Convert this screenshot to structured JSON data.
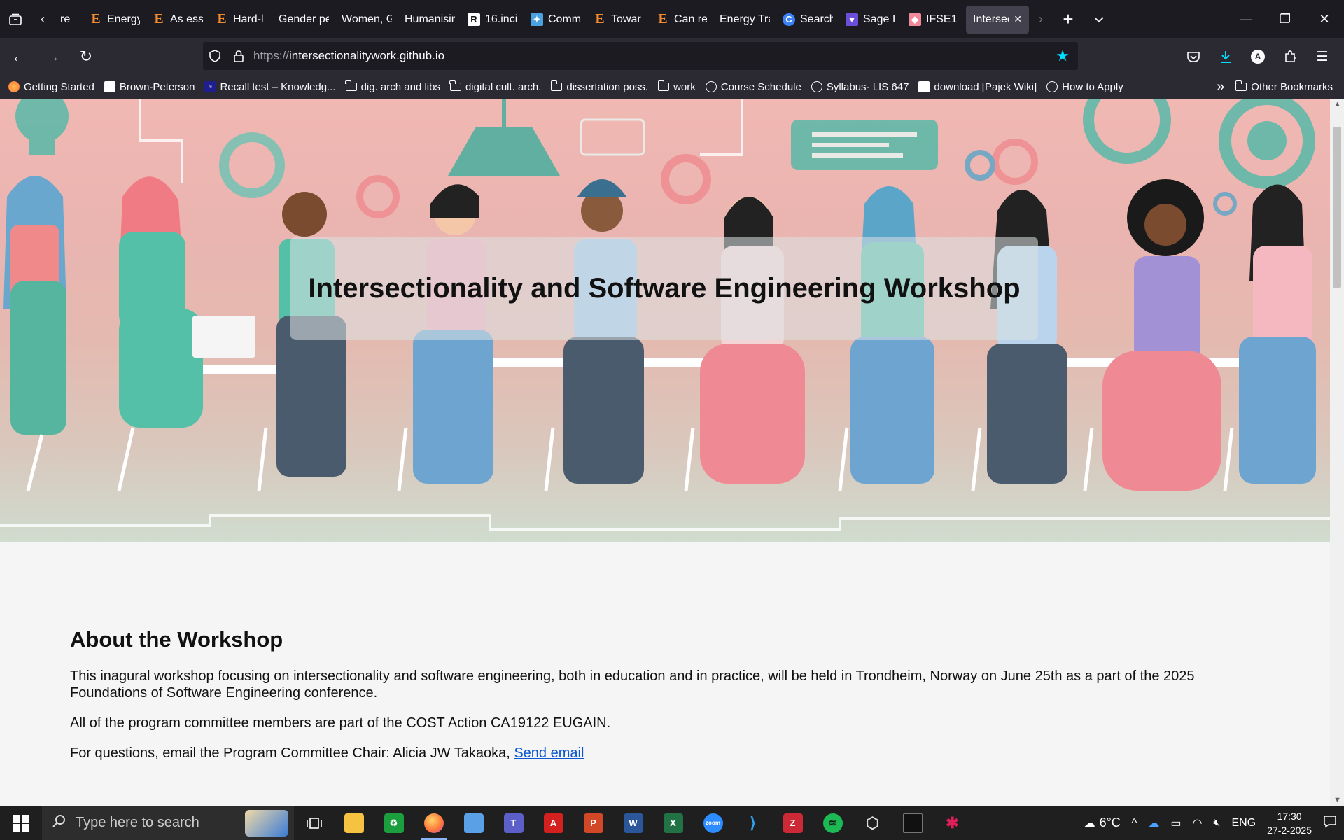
{
  "browser": {
    "tabs": [
      {
        "label": "re",
        "icon": "generic-tab-icon"
      },
      {
        "label": "Energy",
        "icon": "elsevier-icon"
      },
      {
        "label": "As ess",
        "icon": "elsevier-icon"
      },
      {
        "label": "Hard-l",
        "icon": "elsevier-icon"
      },
      {
        "label": "Gender pe",
        "icon": "none"
      },
      {
        "label": "Women, G",
        "icon": "none"
      },
      {
        "label": "Humanisin",
        "icon": "none"
      },
      {
        "label": "16.inci",
        "icon": "researchgate-icon"
      },
      {
        "label": "Comm",
        "icon": "puzzle-icon"
      },
      {
        "label": "Towar",
        "icon": "elsevier-icon"
      },
      {
        "label": "Can re",
        "icon": "elsevier-icon"
      },
      {
        "label": "Energy Tra",
        "icon": "none"
      },
      {
        "label": "Search",
        "icon": "c-icon"
      },
      {
        "label": "Sage I",
        "icon": "heart-icon"
      },
      {
        "label": "IFSE1",
        "icon": "pink-icon"
      },
      {
        "label": "Intersec",
        "icon": "none",
        "active": true
      }
    ],
    "url": {
      "proto": "https://",
      "host": "intersectionalitywork.github.io"
    },
    "bookmarks": [
      {
        "label": "Getting Started",
        "icon": "firefox-icon"
      },
      {
        "label": "Brown-Peterson",
        "icon": "page-icon"
      },
      {
        "label": "Recall test – Knowledg...",
        "icon": "recall-icon"
      },
      {
        "label": "dig. arch and libs",
        "icon": "folder-icon"
      },
      {
        "label": "digital cult. arch.",
        "icon": "folder-icon"
      },
      {
        "label": "dissertation poss.",
        "icon": "folder-icon"
      },
      {
        "label": "work",
        "icon": "folder-icon"
      },
      {
        "label": "Course Schedule",
        "icon": "globe-icon"
      },
      {
        "label": "Syllabus- LIS 647",
        "icon": "globe-icon"
      },
      {
        "label": "download [Pajek Wiki]",
        "icon": "pajek-icon"
      },
      {
        "label": "How to Apply",
        "icon": "globe-icon"
      }
    ],
    "other_bookmarks": "Other Bookmarks"
  },
  "page": {
    "hero_title": "Intersectionality and Software Engineering Workshop",
    "about_heading": "About the Workshop",
    "p1": "This inagural workshop focusing on intersectionality and software engineering, both in education and in practice, will be held in Trondheim, Norway on June 25th as a part of the 2025 Foundations of Software Engineering conference.",
    "p2": "All of the program committee members are part of the COST Action CA19122 EUGAIN.",
    "p3_prefix": "For questions, email the Program Committee Chair: Alicia JW Takaoka, ",
    "p3_link": "Send email"
  },
  "taskbar": {
    "search_placeholder": "Type here to search",
    "weather": "6°C",
    "lang": "ENG",
    "time": "17:30",
    "date": "27-2-2025",
    "apps": [
      {
        "name": "task-view",
        "label": "",
        "color": "#1f1f1f"
      },
      {
        "name": "file-explorer",
        "label": "",
        "color": "#f5c242"
      },
      {
        "name": "recycle-app",
        "label": "♻",
        "color": "#1b9e3e"
      },
      {
        "name": "firefox",
        "label": "",
        "color": "#ff7139",
        "active": true
      },
      {
        "name": "maps",
        "label": "",
        "color": "#5aa0e6"
      },
      {
        "name": "teams",
        "label": "T",
        "color": "#5b5fc7"
      },
      {
        "name": "acrobat",
        "label": "A",
        "color": "#d4201f"
      },
      {
        "name": "powerpoint",
        "label": "P",
        "color": "#d24726"
      },
      {
        "name": "word",
        "label": "W",
        "color": "#2b579a"
      },
      {
        "name": "excel",
        "label": "X",
        "color": "#217346"
      },
      {
        "name": "zoom",
        "label": "zoom",
        "color": "#2d8cff"
      },
      {
        "name": "vscode",
        "label": "",
        "color": "#0078d4"
      },
      {
        "name": "zotero",
        "label": "Z",
        "color": "#cc2936"
      },
      {
        "name": "spotify",
        "label": "",
        "color": "#1db954"
      },
      {
        "name": "unity",
        "label": "",
        "color": "#444"
      },
      {
        "name": "terminal",
        "label": "",
        "color": "#111"
      },
      {
        "name": "slack",
        "label": "",
        "color": "#ffffff"
      }
    ]
  }
}
